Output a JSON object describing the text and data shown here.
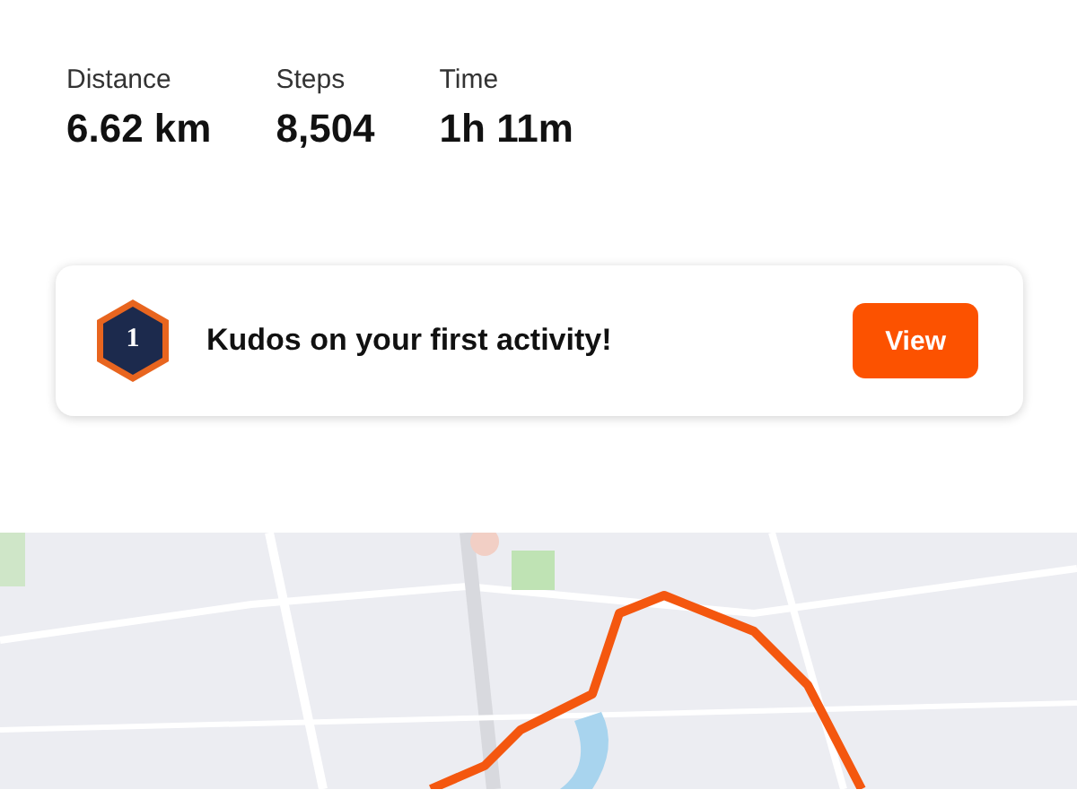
{
  "stats": [
    {
      "label": "Distance",
      "value": "6.62 km"
    },
    {
      "label": "Steps",
      "value": "8,504"
    },
    {
      "label": "Time",
      "value": "1h 11m"
    }
  ],
  "kudos": {
    "badge": "1",
    "message": "Kudos on your first activity!",
    "button": "View"
  }
}
